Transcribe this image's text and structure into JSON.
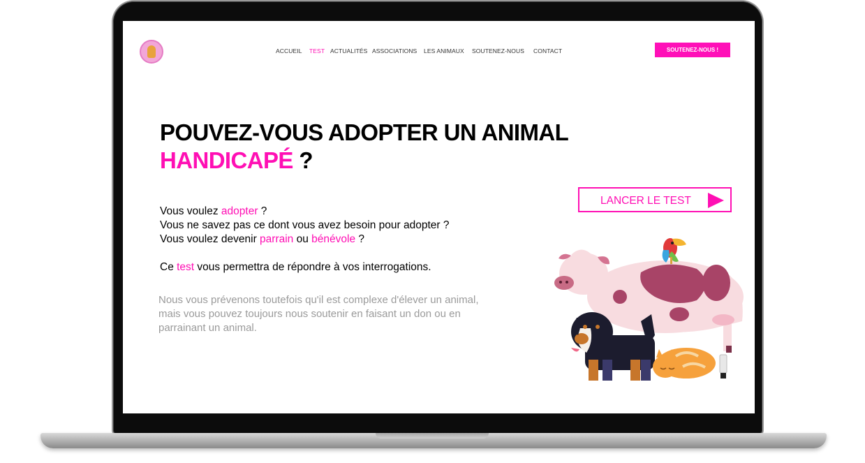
{
  "nav": {
    "logo_icon": "shelter-logo-icon",
    "items": [
      {
        "label": "ACCUEIL",
        "active": false
      },
      {
        "label": "TEST",
        "active": true
      },
      {
        "label": "ACTUALITÉS",
        "active": false
      },
      {
        "label": "ASSOCIATIONS",
        "active": false
      },
      {
        "label": "LES ANIMAUX",
        "active": false
      },
      {
        "label": "SOUTENEZ-NOUS",
        "active": false
      },
      {
        "label": "CONTACT",
        "active": false
      }
    ],
    "cta_label": "SOUTENEZ-NOUS !"
  },
  "hero": {
    "title_line1": "POUVEZ-VOUS ADOPTER UN ANIMAL",
    "title_highlight": "HANDICAPÉ",
    "title_end": " ?",
    "line1_a": "Vous voulez ",
    "line1_link": "adopter",
    "line1_b": " ?",
    "line2": "Vous ne savez pas ce dont vous avez besoin pour adopter ?",
    "line3_a": "Vous voulez devenir ",
    "line3_link1": "parrain",
    "line3_mid": " ou ",
    "line3_link2": "bénévole",
    "line3_b": " ?",
    "line4_a": "Ce ",
    "line4_link": "test",
    "line4_b": " vous permettra de répondre à vos interrogations.",
    "disclaimer": "Nous vous prévenons toutefois qu'il est complexe d'élever un animal, mais vous pouvez toujours nous soutenir en faisant un don ou en parrainant un animal.",
    "test_button_label": "LANCER LE TEST",
    "test_button_icon": "play-triangle-icon"
  },
  "colors": {
    "accent": "#ff0fb4",
    "text": "#000000",
    "muted": "#9a9a9a"
  }
}
